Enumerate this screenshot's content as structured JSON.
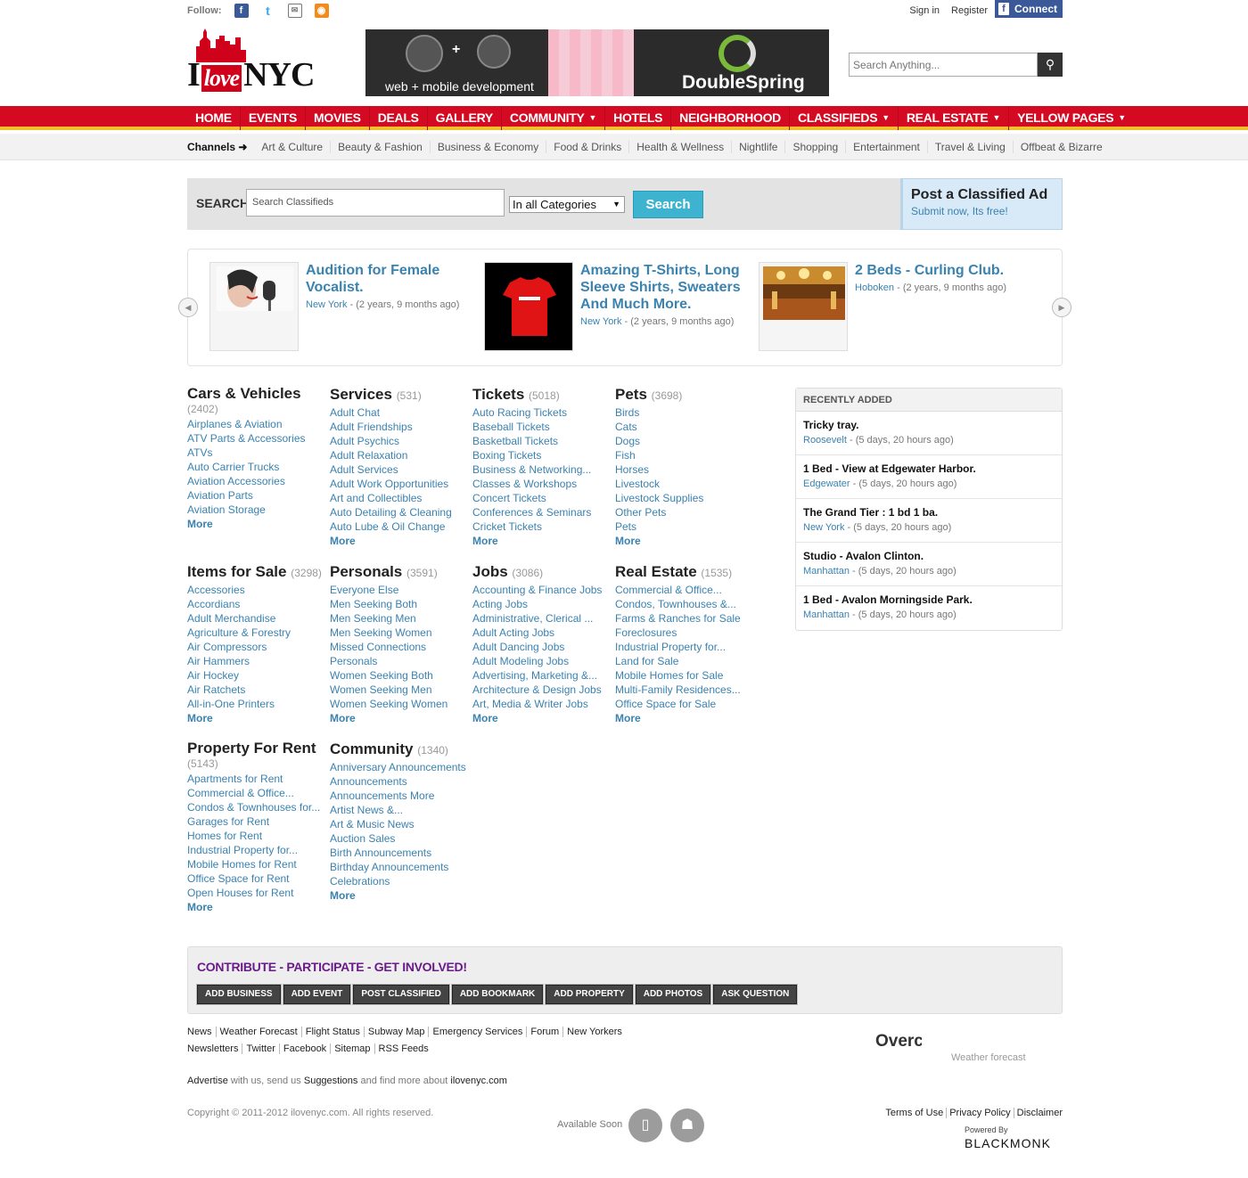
{
  "topbar": {
    "follow_label": "Follow:",
    "sign_in": "Sign in",
    "register": "Register",
    "fb_connect": "Connect"
  },
  "header": {
    "logo_left": "I",
    "logo_heart": "love",
    "logo_right": "NYC",
    "banner_caption": "web + mobile development",
    "banner_brand": "DoubleSpring",
    "search_placeholder": "Search Anything..."
  },
  "nav": {
    "items": [
      {
        "label": "HOME",
        "dropdown": false
      },
      {
        "label": "EVENTS",
        "dropdown": false
      },
      {
        "label": "MOVIES",
        "dropdown": false
      },
      {
        "label": "DEALS",
        "dropdown": false
      },
      {
        "label": "GALLERY",
        "dropdown": false
      },
      {
        "label": "COMMUNITY",
        "dropdown": true
      },
      {
        "label": "HOTELS",
        "dropdown": false
      },
      {
        "label": "NEIGHBORHOOD",
        "dropdown": false
      },
      {
        "label": "CLASSIFIEDS",
        "dropdown": true
      },
      {
        "label": "REAL ESTATE",
        "dropdown": true
      },
      {
        "label": "YELLOW PAGES",
        "dropdown": true
      }
    ]
  },
  "channels": {
    "label": "Channels ➜",
    "items": [
      "Art & Culture",
      "Beauty & Fashion",
      "Business & Economy",
      "Food & Drinks",
      "Health & Wellness",
      "Nightlife",
      "Shopping",
      "Entertainment",
      "Travel & Living",
      "Offbeat & Bizarre"
    ]
  },
  "classified_search": {
    "label": "SEARCH",
    "placeholder": "Search Classifieds",
    "category": "In all Categories",
    "button": "Search"
  },
  "post_ad": {
    "title": "Post a Classified Ad",
    "subtitle": "Submit now, Its free!"
  },
  "carousel": [
    {
      "title": "Audition for Female Vocalist.",
      "location": "New York",
      "age": " - (2 years, 9 months ago)"
    },
    {
      "title": "Amazing T-Shirts, Long Sleeve Shirts, Sweaters And Much More.",
      "location": "New York",
      "age": " - (2 years, 9 months ago)"
    },
    {
      "title": "2 Beds - Curling Club.",
      "location": "Hoboken",
      "age": " - (2 years, 9 months ago)"
    }
  ],
  "categories": [
    {
      "name": "Cars & Vehicles",
      "count": "(2402)",
      "items": [
        "Airplanes & Aviation",
        "ATV Parts & Accessories",
        "ATVs",
        "Auto Carrier Trucks",
        "Aviation Accessories",
        "Aviation Parts",
        "Aviation Storage"
      ],
      "more": "More"
    },
    {
      "name": "Services",
      "count": "(531)",
      "items": [
        "Adult Chat",
        "Adult Friendships",
        "Adult Psychics",
        "Adult Relaxation",
        "Adult Services",
        "Adult Work Opportunities",
        "Art and Collectibles",
        "Auto Detailing & Cleaning",
        "Auto Lube & Oil Change"
      ],
      "more": "More"
    },
    {
      "name": "Tickets",
      "count": "(5018)",
      "items": [
        "Auto Racing Tickets",
        "Baseball Tickets",
        "Basketball Tickets",
        "Boxing Tickets",
        "Business & Networking...",
        "Classes & Workshops",
        "Concert Tickets",
        "Conferences & Seminars",
        "Cricket Tickets"
      ],
      "more": "More"
    },
    {
      "name": "Pets",
      "count": "(3698)",
      "items": [
        "Birds",
        "Cats",
        "Dogs",
        "Fish",
        "Horses",
        "Livestock",
        "Livestock Supplies",
        "Other Pets",
        "Pets"
      ],
      "more": "More"
    },
    {
      "name": "Items for Sale",
      "count": "(3298)",
      "items": [
        "Accessories",
        "Accordians",
        "Adult Merchandise",
        "Agriculture & Forestry",
        "Air Compressors",
        "Air Hammers",
        "Air Hockey",
        "Air Ratchets",
        "All-in-One Printers"
      ],
      "more": "More"
    },
    {
      "name": "Personals",
      "count": "(3591)",
      "items": [
        "Everyone Else",
        "Men Seeking Both",
        "Men Seeking Men",
        "Men Seeking Women",
        "Missed Connections",
        "Personals",
        "Women Seeking Both",
        "Women Seeking Men",
        "Women Seeking Women"
      ],
      "more": "More"
    },
    {
      "name": "Jobs",
      "count": "(3086)",
      "items": [
        "Accounting & Finance Jobs",
        "Acting Jobs",
        "Administrative, Clerical ...",
        "Adult Acting Jobs",
        "Adult Dancing Jobs",
        "Adult Modeling Jobs",
        "Advertising, Marketing &...",
        "Architecture & Design Jobs",
        "Art, Media & Writer Jobs"
      ],
      "more": "More"
    },
    {
      "name": "Real Estate",
      "count": "(1535)",
      "items": [
        "Commercial & Office...",
        "Condos, Townhouses &...",
        "Farms & Ranches for Sale",
        "Foreclosures",
        "Industrial Property for...",
        "Land for Sale",
        "Mobile Homes for Sale",
        "Multi-Family Residences...",
        "Office Space for Sale"
      ],
      "more": "More"
    },
    {
      "name": "Property For Rent",
      "count": "(5143)",
      "items": [
        "Apartments for Rent",
        "Commercial & Office...",
        "Condos & Townhouses for...",
        "Garages for Rent",
        "Homes for Rent",
        "Industrial Property for...",
        "Mobile Homes for Rent",
        "Office Space for Rent",
        "Open Houses for Rent"
      ],
      "more": "More"
    },
    {
      "name": "Community",
      "count": "(1340)",
      "items": [
        "Anniversary Announcements",
        "Announcements",
        "Announcements More",
        "Artist News &...",
        "Art & Music News",
        "Auction Sales",
        "Birth Announcements",
        "Birthday Announcements",
        "Celebrations"
      ],
      "more": "More"
    }
  ],
  "recent": {
    "heading": "RECENTLY ADDED",
    "items": [
      {
        "title": "Tricky tray.",
        "location": "Roosevelt",
        "age": " - (5 days, 20 hours ago)"
      },
      {
        "title": "1 Bed - View at Edgewater Harbor.",
        "location": "Edgewater",
        "age": " - (5 days, 20 hours ago)"
      },
      {
        "title": "The Grand Tier : 1 bd 1 ba.",
        "location": "New York",
        "age": " - (5 days, 20 hours ago)"
      },
      {
        "title": "Studio - Avalon Clinton.",
        "location": "Manhattan",
        "age": " - (5 days, 20 hours ago)"
      },
      {
        "title": "1 Bed - Avalon Morningside Park.",
        "location": "Manhattan",
        "age": " - (5 days, 20 hours ago)"
      }
    ]
  },
  "contribute": {
    "title": "CONTRIBUTE - PARTICIPATE - GET INVOLVED!",
    "buttons": [
      "ADD BUSINESS",
      "ADD EVENT",
      "POST CLASSIFIED",
      "ADD BOOKMARK",
      "ADD PROPERTY",
      "ADD PHOTOS",
      "ASK QUESTION"
    ]
  },
  "footer": {
    "links1": [
      "News",
      "Weather Forecast",
      "Flight Status",
      "Subway Map",
      "Emergency Services",
      "Forum",
      "New Yorkers"
    ],
    "links2": [
      "Newsletters",
      "Twitter",
      "Facebook",
      "Sitemap",
      "RSS Feeds"
    ],
    "advertise": "Advertise",
    "mid1": " with us, send us ",
    "suggestions": "Suggestions",
    "mid2": " and find more about ",
    "site": "ilovenyc.com",
    "weather_text": "Overcast",
    "weather_label": "Weather forecast",
    "copyright": "Copyright © 2011-2012 ilovenyc.com. All rights reserved.",
    "available": "Available Soon",
    "legal": [
      "Terms of Use",
      "Privacy Policy",
      "Disclaimer"
    ],
    "powered": "Powered By",
    "brand": "BLACKMONK"
  },
  "colors": {
    "nav_red": "#d40a22",
    "nav_yellow": "#f0c02a",
    "link_blue": "#3a82b0",
    "search_button": "#3eb3cf",
    "contribute_purple": "#6a1b8a"
  }
}
